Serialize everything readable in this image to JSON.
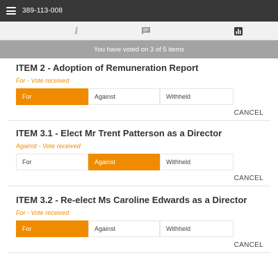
{
  "header": {
    "menu_icon": "hamburger-menu-icon",
    "title": "389-113-008"
  },
  "tabs": [
    {
      "icon": "info-icon",
      "glyph": "i",
      "active": false
    },
    {
      "icon": "chat-bubble-icon",
      "active": false
    },
    {
      "icon": "bar-chart-icon",
      "active": true
    }
  ],
  "status": {
    "text": "You have voted on 3 of 5 items"
  },
  "options_labels": [
    "For",
    "Against",
    "Withheld"
  ],
  "items": [
    {
      "title": "ITEM 2 - Adoption of Remuneration Report",
      "status": "For - Vote received",
      "options": [
        "For",
        "Against",
        "Withheld"
      ],
      "selected": "For",
      "cancel": "CANCEL"
    },
    {
      "title": "ITEM 3.1 - Elect Mr Trent Patterson as a Director",
      "status": "Against - Vote received",
      "options": [
        "For",
        "Against",
        "Withheld"
      ],
      "selected": "Against",
      "cancel": "CANCEL"
    },
    {
      "title": "ITEM 3.2 - Re-elect Ms Caroline Edwards as a Director",
      "status": "For - Vote received",
      "options": [
        "For",
        "Against",
        "Withheld"
      ],
      "selected": "For",
      "cancel": "CANCEL"
    }
  ],
  "colors": {
    "header_bg": "#383838",
    "tab_bg": "#f1f1f1",
    "status_bg": "#a3a3a3",
    "accent": "#f08b00",
    "text": "#333333"
  }
}
